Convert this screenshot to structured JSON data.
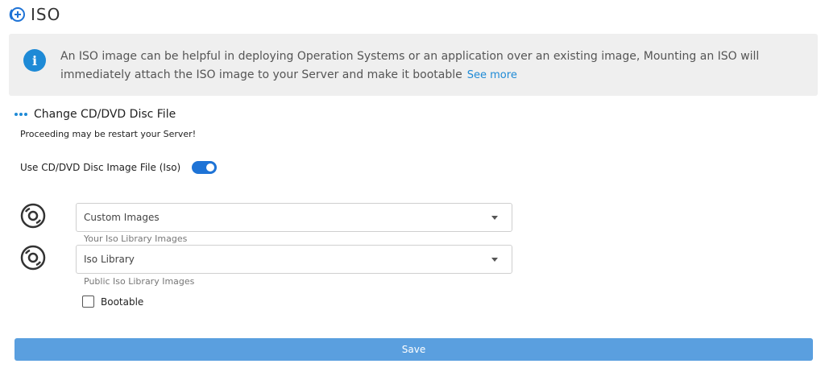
{
  "header": {
    "title": "ISO",
    "icon": "disc-plus-icon",
    "accent_color": "#1e73d6"
  },
  "info": {
    "icon": "info-icon",
    "text_line1": "An ISO image can be helpful in deploying Operation Systems or an application over an existing image, Mounting an ISO will",
    "text_line2": "immediately attach the ISO image to your Server and make it bootable",
    "link": "See more"
  },
  "section": {
    "icon": "dots-icon",
    "title": "Change CD/DVD Disc File",
    "warning": "Proceeding may be restart your Server!"
  },
  "toggle": {
    "label": "Use CD/DVD Disc Image File (Iso)",
    "on": true
  },
  "selects": [
    {
      "icon": "disc-icon",
      "value": "Custom Images",
      "helper": "Your Iso Library Images"
    },
    {
      "icon": "disc-icon",
      "value": "Iso Library",
      "helper": "Public Iso Library Images"
    }
  ],
  "bootable": {
    "label": "Bootable",
    "checked": false
  },
  "save_label": "Save"
}
